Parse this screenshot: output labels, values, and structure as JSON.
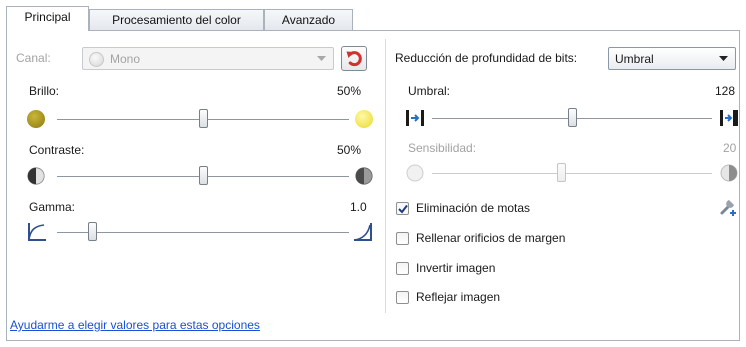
{
  "tabs": [
    {
      "label": "Principal",
      "active": true
    },
    {
      "label": "Procesamiento del color",
      "active": false
    },
    {
      "label": "Avanzado",
      "active": false
    }
  ],
  "left": {
    "channel_label": "Canal:",
    "channel_value": "Mono",
    "brightness": {
      "label": "Brillo:",
      "value_text": "50%",
      "level": 0.5
    },
    "contrast": {
      "label": "Contraste:",
      "value_text": "50%",
      "level": 0.5
    },
    "gamma": {
      "label": "Gamma:",
      "value_text": "1.0",
      "level": 0.12
    }
  },
  "right": {
    "bitdepth_label": "Reducción de profundidad de bits:",
    "bitdepth_value": "Umbral",
    "threshold": {
      "label": "Umbral:",
      "value_text": "128",
      "level": 0.5
    },
    "sensitivity": {
      "label": "Sensibilidad:",
      "value_text": "20",
      "level": 0.46,
      "enabled": false
    },
    "options": [
      {
        "label": "Eliminación de motas",
        "checked": true
      },
      {
        "label": "Rellenar orificios de margen",
        "checked": false
      },
      {
        "label": "Invertir imagen",
        "checked": false
      },
      {
        "label": "Reflejar imagen",
        "checked": false
      }
    ]
  },
  "help_link": "Ayudarme a elegir valores para estas opciones",
  "colors": {
    "accent": "#1a4fd6",
    "reset": "#d2322d",
    "brightness_dark": "#9c8a12",
    "brightness_light": "#f2e43a"
  },
  "icons": [
    "reset-icon",
    "brightness-low-icon",
    "brightness-high-icon",
    "contrast-low-icon",
    "contrast-high-icon",
    "gamma-low-icon",
    "gamma-high-icon",
    "threshold-low-icon",
    "threshold-high-icon",
    "settings-tool-icon",
    "dropdown-arrow-icon"
  ]
}
